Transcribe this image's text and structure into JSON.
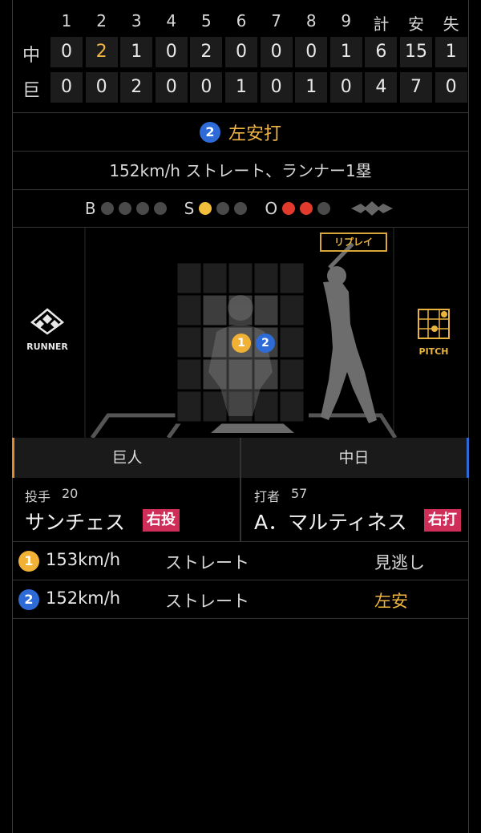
{
  "scoreboard": {
    "headers": [
      "1",
      "2",
      "3",
      "4",
      "5",
      "6",
      "7",
      "8",
      "9",
      "計",
      "安",
      "失"
    ],
    "teams": [
      {
        "name": "中",
        "scores": [
          "0",
          "2",
          "1",
          "0",
          "2",
          "0",
          "0",
          "0",
          "1",
          "6",
          "15",
          "1"
        ],
        "highlight_index": 1
      },
      {
        "name": "巨",
        "scores": [
          "0",
          "0",
          "2",
          "0",
          "0",
          "1",
          "0",
          "1",
          "0",
          "4",
          "7",
          "0"
        ],
        "highlight_index": -1
      }
    ]
  },
  "play": {
    "number": "2",
    "result": "左安打"
  },
  "detail": "152km/h ストレート、ランナー1塁",
  "count": {
    "labels": {
      "b": "B",
      "s": "S",
      "o": "O"
    },
    "balls": 0,
    "strikes": 1,
    "outs": 2
  },
  "field": {
    "runner_label": "RUNNER",
    "pitch_label": "PITCH",
    "replay_label": "リプレイ",
    "pitch_markers": [
      "1",
      "2"
    ]
  },
  "matchup": {
    "home_team": "巨人",
    "away_team": "中日",
    "pitcher": {
      "role": "投手",
      "number": "20",
      "name": "サンチェス",
      "hand": "右投"
    },
    "batter": {
      "role": "打者",
      "number": "57",
      "name": "A．マルティネス",
      "hand": "右打"
    }
  },
  "pitches": [
    {
      "num": "1",
      "color": "yellow",
      "speed": "153km/h",
      "type": "ストレート",
      "result": "見逃し",
      "hit": false
    },
    {
      "num": "2",
      "color": "blue",
      "speed": "152km/h",
      "type": "ストレート",
      "result": "左安",
      "hit": true
    }
  ],
  "colors": {
    "accent": "#f0b543",
    "blue": "#2f6bd6",
    "yellow": "#f0b135",
    "red": "#e23a2c",
    "badge": "#cf2e58"
  }
}
